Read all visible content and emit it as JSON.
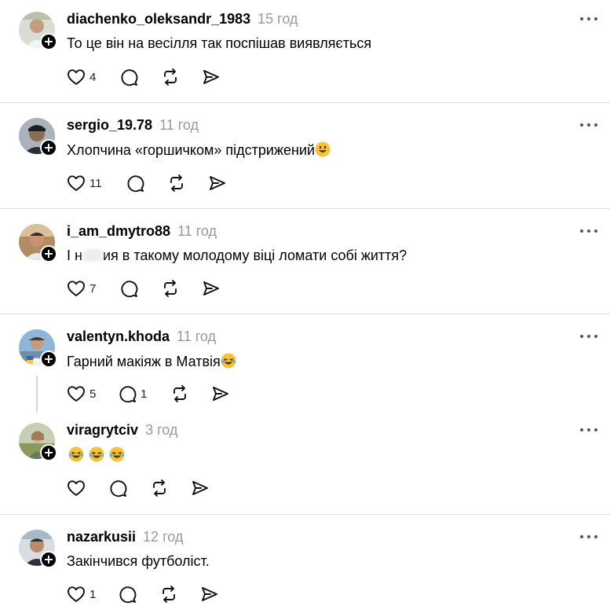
{
  "posts": [
    {
      "username": "diachenko_oleksandr_1983",
      "time": "15 год",
      "text": "То це він на весілля так поспішав виявляється",
      "likes": "4",
      "replies": "",
      "avatar_bg": "#cfd6c8"
    },
    {
      "username": "sergio_19.78",
      "time": "11 год",
      "text": "Хлопчина «горшичком» підстрижений",
      "likes": "11",
      "replies": "",
      "avatar_bg": "#3a3f44"
    },
    {
      "username": "i_am_dmytro88",
      "time": "11 год",
      "text_before": "І н",
      "text_after": "ия в такому молодому віці ломати собі життя?",
      "likes": "7",
      "replies": "",
      "avatar_bg": "#8a6b52"
    },
    {
      "username": "valentyn.khoda",
      "time": "11 год",
      "text": "Гарний макіяж в Матвія",
      "likes": "5",
      "replies": "1",
      "avatar_bg": "#7fa6c9"
    },
    {
      "username": "viragrytciv",
      "time": "3 год",
      "text": "",
      "likes": "",
      "replies": "",
      "avatar_bg": "#9fb07c"
    },
    {
      "username": "nazarkusii",
      "time": "12 год",
      "text": "Закінчився футболіст.",
      "likes": "1",
      "replies": "",
      "avatar_bg": "#5c6670"
    }
  ],
  "icons": {
    "like": "heart-icon",
    "reply": "comment-icon",
    "repost": "repost-icon",
    "share": "share-icon",
    "more": "more-icon",
    "follow": "follow-plus-icon"
  },
  "colors": {
    "time": "#999999",
    "separator": "#dcdcdc",
    "emoji": "#f5c33b"
  }
}
